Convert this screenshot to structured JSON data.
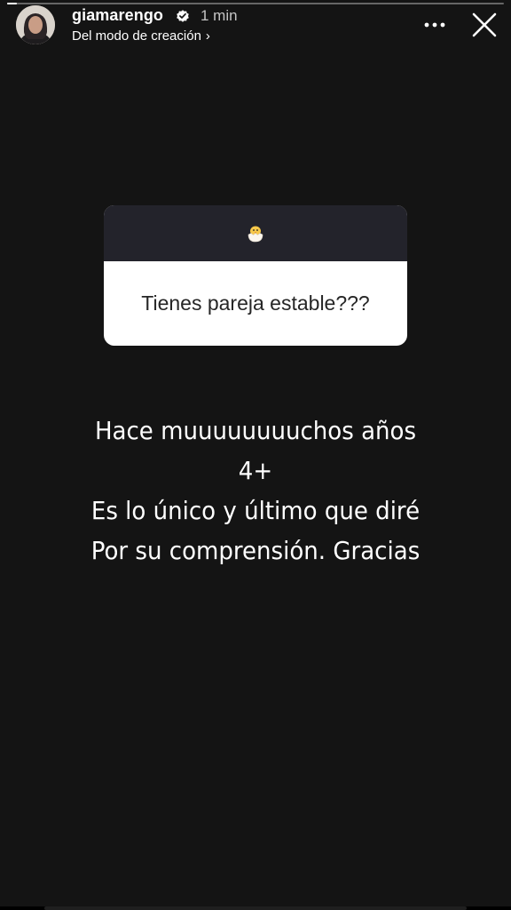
{
  "story": {
    "progress": 0.02,
    "background_color": "#141414"
  },
  "header": {
    "username": "giamarengo",
    "verified_icon": "verified-badge-icon",
    "time_ago": "1 min",
    "subtitle": "Del modo de creación",
    "subtitle_chevron": "›",
    "more_icon": "more-horizontal-icon",
    "close_icon": "close-icon"
  },
  "question_sticker": {
    "emoji_icon": "hatching-chick-icon",
    "question": "Tienes pareja estable???"
  },
  "response": {
    "lines": [
      "Hace muuuuuuuuchos años",
      "4+",
      "Es lo único y último que diré",
      "Por su comprensión. Gracias"
    ]
  }
}
